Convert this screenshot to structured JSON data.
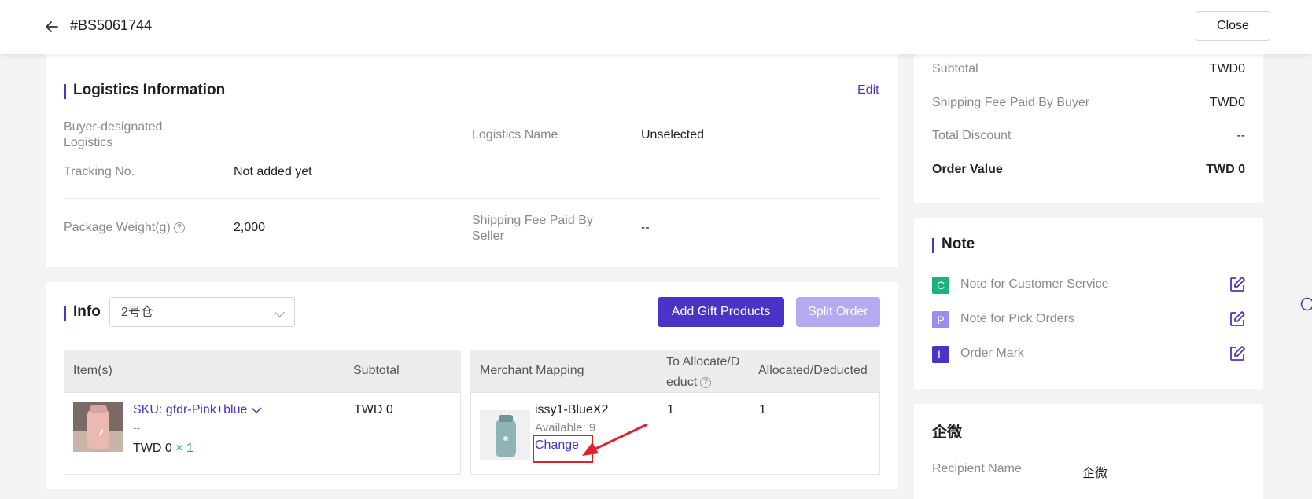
{
  "header": {
    "order_number": "#BS5061744",
    "close_label": "Close"
  },
  "logistics": {
    "title": "Logistics Information",
    "edit_label": "Edit",
    "buyer_designated_label": "Buyer-designated\nLogistics",
    "logistics_name_label": "Logistics Name",
    "logistics_name_value": "Unselected",
    "tracking_label": "Tracking No.",
    "tracking_value": "Not added yet",
    "package_weight_label": "Package Weight(g)",
    "package_weight_value": "2,000",
    "seller_fee_label": "Shipping Fee Paid By\nSeller",
    "seller_fee_value": "--"
  },
  "info": {
    "title": "Info",
    "warehouse_select": "2号仓",
    "add_gift_label": "Add Gift Products",
    "split_order_label": "Split Order",
    "columns_left": [
      "Item(s)",
      "Subtotal"
    ],
    "columns_right": [
      "Merchant Mapping",
      "To Allocate/D\neduct",
      "Allocated/Deducted"
    ],
    "item": {
      "sku": "SKU: gfdr-Pink+blue",
      "dash": "--",
      "price": "TWD 0",
      "times": "×",
      "qty": "1",
      "subtotal": "TWD 0"
    },
    "mapping": {
      "name": "issy1-BlueX2",
      "available": "Available: 9",
      "change_label": "Change",
      "to_allocate": "1",
      "allocated": "1"
    }
  },
  "summary": {
    "rows": [
      {
        "label": "Subtotal",
        "value": "TWD0"
      },
      {
        "label": "Shipping Fee Paid By Buyer",
        "value": "TWD0"
      },
      {
        "label": "Total Discount",
        "value": "--"
      }
    ],
    "order_value_label": "Order Value",
    "order_value": "TWD 0"
  },
  "note": {
    "title": "Note",
    "items": [
      {
        "badge": "C",
        "label": "Note for Customer Service",
        "color": "#19b47c"
      },
      {
        "badge": "P",
        "label": "Note for Pick Orders",
        "color": "#9b8cf0"
      },
      {
        "badge": "L",
        "label": "Order Mark",
        "color": "#4a34c7"
      }
    ]
  },
  "recipient": {
    "title": "企微",
    "name_label": "Recipient Name",
    "name_value": "企微"
  },
  "colors": {
    "accent": "#4a34c7",
    "annotation": "#e0202a"
  }
}
